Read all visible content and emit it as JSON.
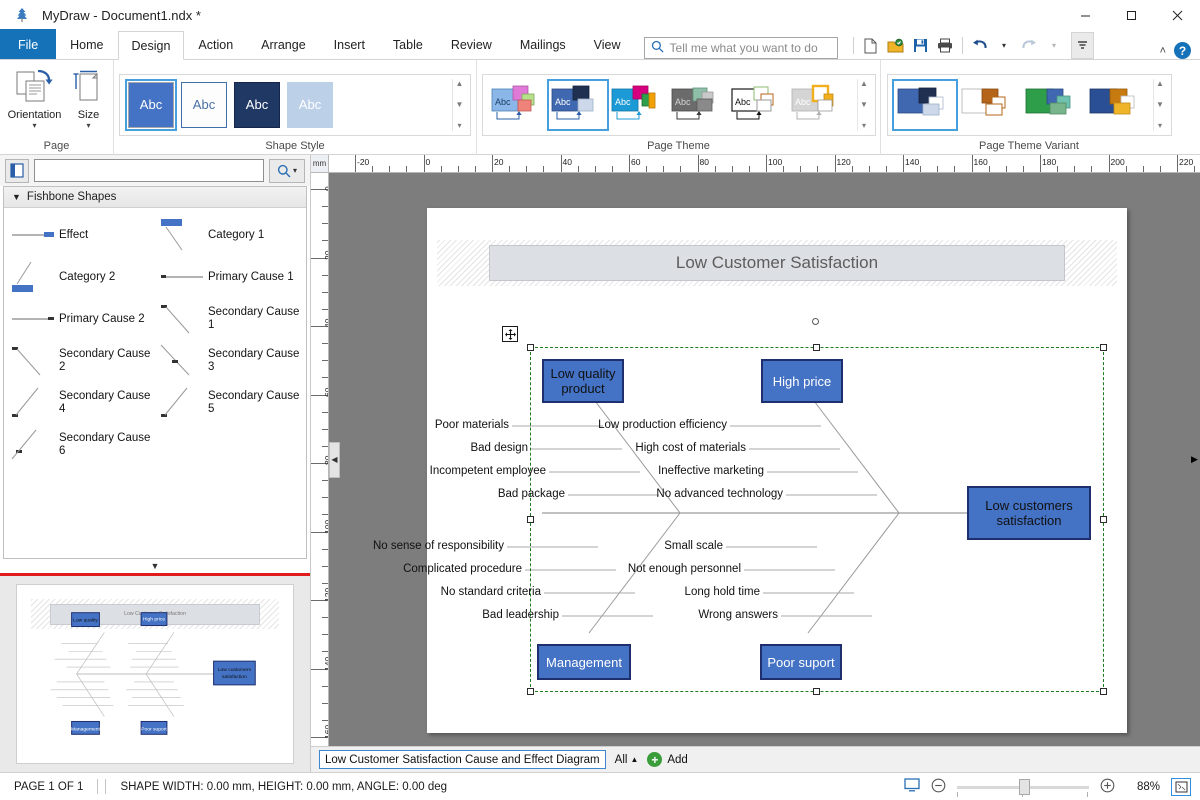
{
  "window": {
    "app_icon": "tree-logo-icon",
    "title": "MyDraw - Document1.ndx *",
    "minimize_label": "—",
    "maximize_label": "□",
    "close_label": "✕"
  },
  "ribbon": {
    "tabs": [
      {
        "label": "File",
        "kind": "file"
      },
      {
        "label": "Home",
        "kind": "normal"
      },
      {
        "label": "Design",
        "kind": "active"
      },
      {
        "label": "Action",
        "kind": "normal"
      },
      {
        "label": "Arrange",
        "kind": "normal"
      },
      {
        "label": "Insert",
        "kind": "normal"
      },
      {
        "label": "Table",
        "kind": "normal"
      },
      {
        "label": "Review",
        "kind": "normal"
      },
      {
        "label": "Mailings",
        "kind": "normal"
      },
      {
        "label": "View",
        "kind": "normal"
      }
    ],
    "tell_me": {
      "placeholder": "Tell me what you want to do",
      "icon": "search-icon"
    },
    "quick_access": [
      {
        "name": "new-document-icon"
      },
      {
        "name": "open-folder-icon"
      },
      {
        "name": "save-icon"
      },
      {
        "name": "print-icon"
      },
      {
        "name": "undo-icon"
      },
      {
        "name": "undo-dropdown-icon"
      },
      {
        "name": "redo-icon"
      },
      {
        "name": "redo-dropdown-icon"
      },
      {
        "name": "customize-qat-icon"
      }
    ],
    "collapse_ribbon": "˄",
    "help": "?",
    "groups": [
      {
        "title": "Page",
        "buttons": [
          {
            "label": "Orientation",
            "icon": "page-orientation-icon",
            "caret": "▾"
          },
          {
            "label": "Size",
            "icon": "page-size-icon",
            "caret": "▾"
          }
        ]
      },
      {
        "title": "Shape Style",
        "items": [
          {
            "label": "Abc",
            "selected": true,
            "fill": "#4472c4",
            "text": "#ffffff"
          },
          {
            "label": "Abc",
            "selected": false,
            "fill": "#fdfdfd",
            "text": "#4a6fa5"
          },
          {
            "label": "Abc",
            "selected": false,
            "fill": "#203864",
            "text": "#ffffff"
          },
          {
            "label": "Abc",
            "selected": false,
            "fill": "#bcd0e8",
            "text": "#ffffff"
          }
        ]
      },
      {
        "title": "Page Theme",
        "items": [
          {
            "label": "Abc",
            "selected": false
          },
          {
            "label": "Abc",
            "selected": true
          },
          {
            "label": "Abc",
            "selected": false
          },
          {
            "label": "Abc",
            "selected": false
          },
          {
            "label": "Abc",
            "selected": false
          },
          {
            "label": "Abc",
            "selected": false
          }
        ]
      },
      {
        "title": "Page Theme Variant",
        "items": [
          {
            "selected": true
          },
          {
            "selected": false
          },
          {
            "selected": false
          },
          {
            "selected": false
          }
        ]
      }
    ]
  },
  "shapes_panel": {
    "doc_button_icon": "document-stencil-icon",
    "search_value": "",
    "search_button_icon": "search-icon",
    "search_dropdown_icon": "chevron-down-icon",
    "stencil_title": "Fishbone Shapes",
    "stencil_expander": "▼",
    "items": [
      {
        "label": "Effect",
        "glyph": "effect-shape"
      },
      {
        "label": "Category 1",
        "glyph": "category1-shape"
      },
      {
        "label": "Category 2",
        "glyph": "category2-shape"
      },
      {
        "label": "Primary Cause 1",
        "glyph": "primary-cause-1-shape"
      },
      {
        "label": "Primary Cause 2",
        "glyph": "primary-cause-2-shape"
      },
      {
        "label": "Secondary Cause 1",
        "glyph": "secondary-cause-1-shape"
      },
      {
        "label": "Secondary Cause 2",
        "glyph": "secondary-cause-2-shape"
      },
      {
        "label": "Secondary Cause 3",
        "glyph": "secondary-cause-3-shape"
      },
      {
        "label": "Secondary Cause 4",
        "glyph": "secondary-cause-4-shape"
      },
      {
        "label": "Secondary Cause 5",
        "glyph": "secondary-cause-5-shape"
      },
      {
        "label": "Secondary Cause 6",
        "glyph": "secondary-cause-6-shape"
      }
    ],
    "more_caret": "▼"
  },
  "rulers": {
    "unit": "mm",
    "horizontal_ticks": [
      "-20",
      "0",
      "20",
      "40",
      "60",
      "80",
      "100",
      "120",
      "140",
      "160",
      "180",
      "200",
      "220"
    ],
    "vertical_ticks": [
      "0",
      "20",
      "40",
      "60",
      "80",
      "100",
      "120",
      "140",
      "160"
    ]
  },
  "page_tabs": {
    "page_name": "Low Customer Satisfaction Cause and Effect Diagram",
    "all_label": "All",
    "all_caret": "▲",
    "add_label": "Add",
    "add_icon": "plus-circle-icon"
  },
  "status_bar": {
    "page_indicator": "PAGE 1 OF 1",
    "shape_info": "SHAPE WIDTH: 0.00 mm, HEIGHT: 0.00 mm, ANGLE: 0.00 deg",
    "view_icon": "presentation-view-icon",
    "zoom_out_icon": "zoom-out-icon",
    "zoom_in_icon": "zoom-in-icon",
    "zoom_level": "88%",
    "fit_page_icon": "fit-to-page-icon"
  },
  "diagram": {
    "title": "Low Customer Satisfaction",
    "effect_box": "Low customers satisfaction",
    "categories_top": [
      {
        "label": "Low quality product",
        "text_color": "#111111"
      },
      {
        "label": "High price",
        "text_color": "#ffffff"
      }
    ],
    "categories_bottom": [
      {
        "label": "Management",
        "text_color": "#ffffff"
      },
      {
        "label": "Poor suport",
        "text_color": "#ffffff"
      }
    ],
    "causes_top_left": [
      "Poor materials",
      "Bad design",
      "Incompetent employee",
      "Bad package"
    ],
    "causes_top_mid": [
      "Low production efficiency",
      "High cost of materials",
      "Ineffective marketing",
      "No advanced technology"
    ],
    "causes_bottom_left": [
      "No sense of responsibility",
      "Complicated procedure",
      "No standard criteria",
      "Bad leadership"
    ],
    "causes_bottom_mid": [
      "Small scale",
      "Not enough personnel",
      "Long hold time",
      "Wrong answers"
    ],
    "colors": {
      "box_fill": "#4472c4",
      "box_border": "#1f2f6e",
      "title_fill": "#dcdfe3",
      "selection": "#1e7a1e",
      "spine": "#9a9a9a"
    }
  }
}
